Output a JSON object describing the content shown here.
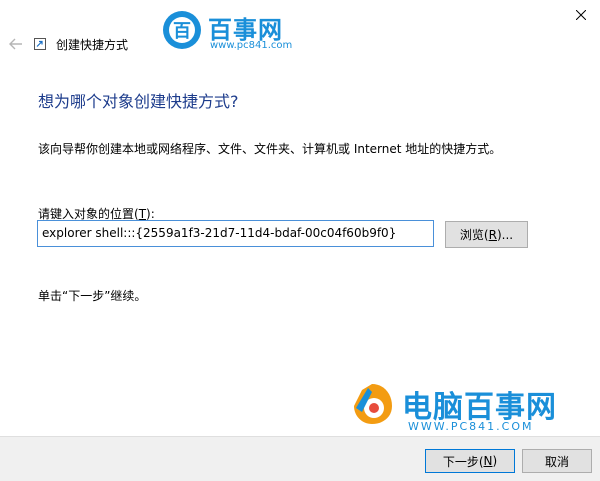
{
  "window": {
    "title": "创建快捷方式",
    "back_icon": "back-arrow-icon",
    "close_icon": "close-icon"
  },
  "watermark_top": {
    "name": "百事网",
    "url": "www.pc841.com",
    "badge_icon": "bai-badge-icon"
  },
  "content": {
    "heading": "想为哪个对象创建快捷方式?",
    "description": "该向导帮你创建本地或网络程序、文件、文件夹、计算机或 Internet 地址的快捷方式。",
    "location_label_prefix": "请键入对象的位置(",
    "location_label_key": "T",
    "location_label_suffix": "):",
    "location_value": "explorer shell:::{2559a1f3-21d7-11d4-bdaf-00c04f60b9f0}",
    "browse_prefix": "浏览(",
    "browse_key": "R",
    "browse_suffix": ")...",
    "hint": "单击“下一步”继续。"
  },
  "watermark_bottom": {
    "name": "电脑百事网",
    "url": "WWW.PC841.COM",
    "logo_icon": "pc841-logo-icon"
  },
  "footer": {
    "next_prefix": "下一步(",
    "next_key": "N",
    "next_suffix": ")",
    "cancel": "取消"
  },
  "colors": {
    "heading": "#1d3c8c",
    "watermark": "#1a8fd9",
    "input_border": "#4a90d9",
    "footer_bg": "#f0f0f0"
  }
}
